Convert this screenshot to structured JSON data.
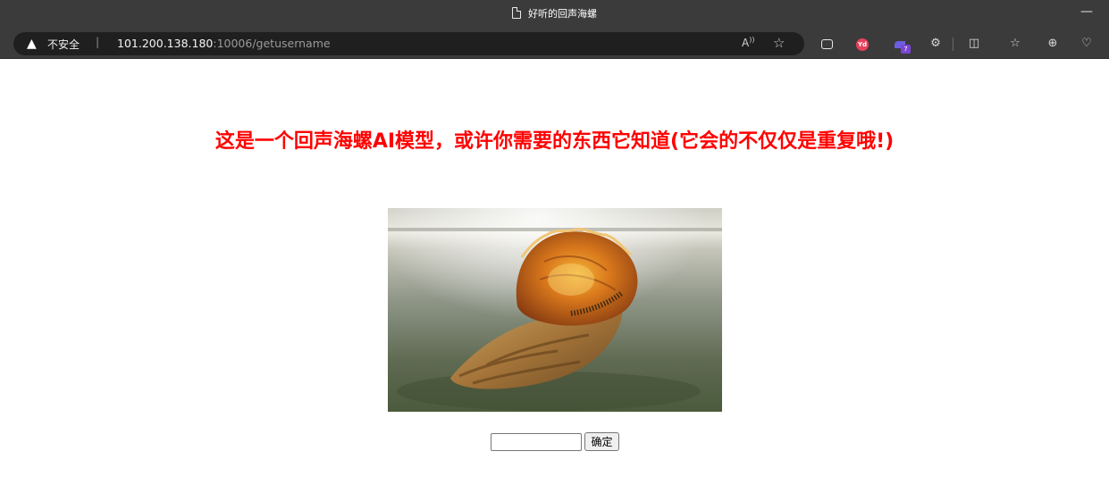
{
  "browser": {
    "tab_title": "好听的回声海螺",
    "minimize_symbol": "—",
    "security_label": "不安全",
    "url_host": "101.200.138.180",
    "url_rest": ":10006/getusername",
    "read_aloud_label": "A̅",
    "extension_badge_count": "7",
    "extension_yd_label": "Yd"
  },
  "page": {
    "headline": "这是一个回声海螺AI模型，或许你需要的东西它知道(它会的不仅仅是重复哦!)",
    "image_alt": "conch shell in shallow water",
    "input_value": "",
    "submit_label": "确定"
  },
  "colors": {
    "headline": "#ff0000",
    "chrome_bg": "#3b3b3b",
    "omnibox_bg": "#1f1f1f"
  }
}
